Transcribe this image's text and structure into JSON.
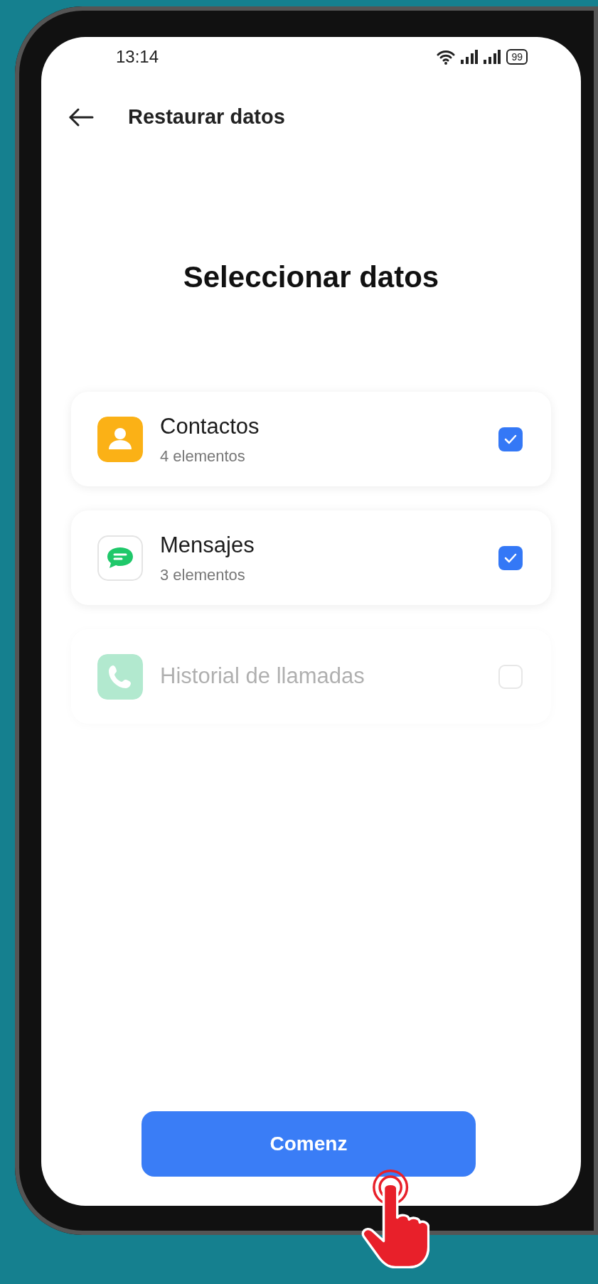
{
  "status_bar": {
    "time": "13:14",
    "battery": "99"
  },
  "header": {
    "title": "Restaurar datos"
  },
  "heading": "Seleccionar datos",
  "items": [
    {
      "kind": "contacts",
      "name": "Contactos",
      "count": "4 elementos",
      "checked": true,
      "disabled": false
    },
    {
      "kind": "messages",
      "name": "Mensajes",
      "count": "3 elementos",
      "checked": true,
      "disabled": false
    },
    {
      "kind": "calls",
      "name": "Historial de llamadas",
      "checked": false,
      "disabled": true
    }
  ],
  "start_button": {
    "label": "Comenz"
  }
}
